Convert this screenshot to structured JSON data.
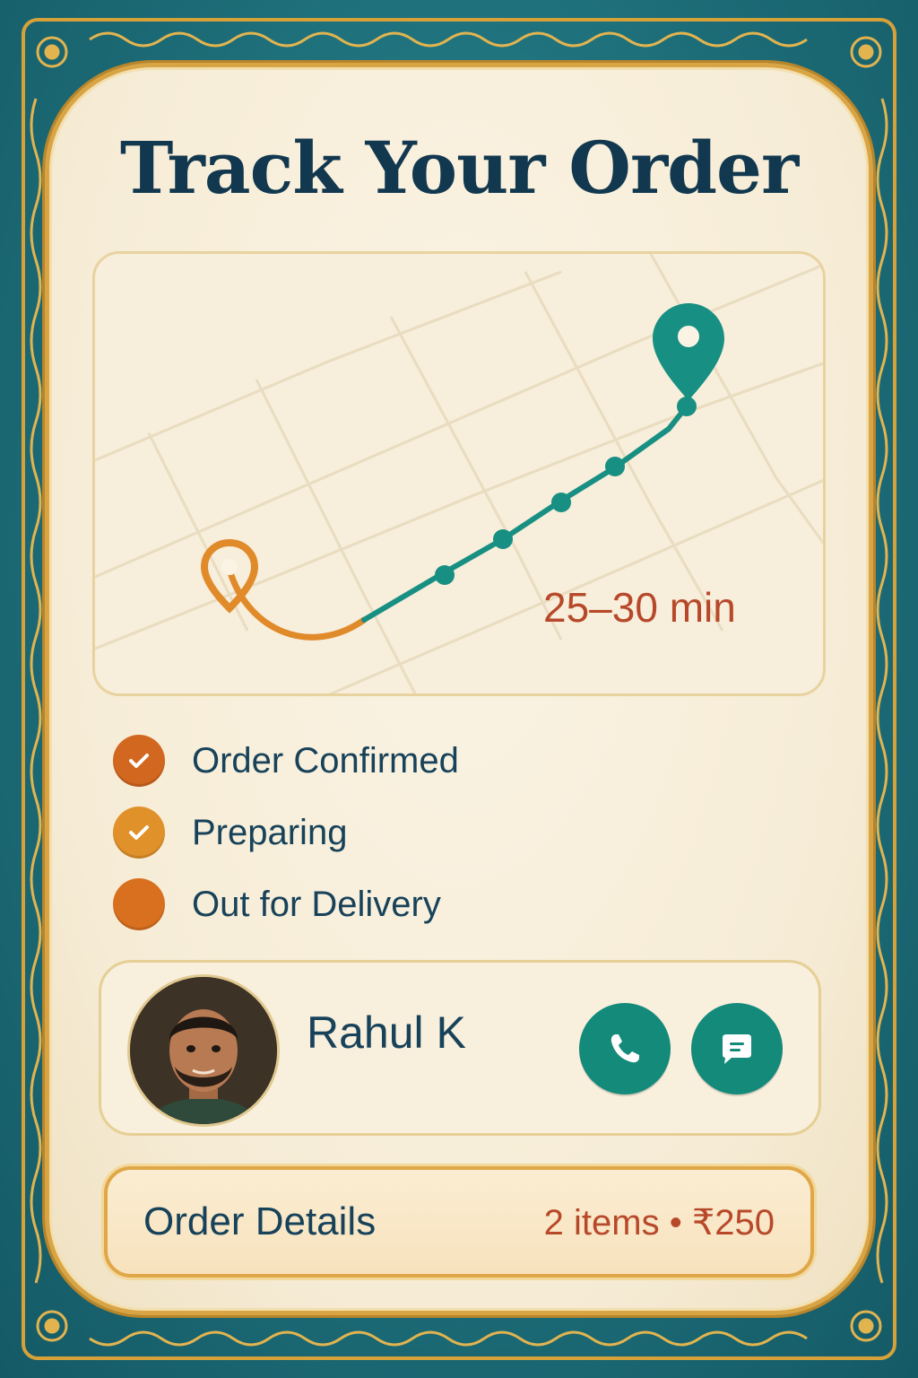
{
  "page": {
    "title": "Track Your Order"
  },
  "map": {
    "eta": "25–30 min",
    "route_colors": {
      "traveled": "#e08a2a",
      "remaining": "#178f82"
    }
  },
  "status": [
    {
      "label": "Order Confirmed",
      "state": "done",
      "color": "#d2671f",
      "icon": "check-icon"
    },
    {
      "label": "Preparing",
      "state": "done",
      "color": "#e1912a",
      "icon": "check-icon"
    },
    {
      "label": "Out for Delivery",
      "state": "current",
      "color": "#d8701f",
      "icon": "none"
    }
  ],
  "driver": {
    "name": "Rahul K",
    "actions": [
      {
        "name": "call-button",
        "icon": "phone-icon"
      },
      {
        "name": "message-button",
        "icon": "chat-icon"
      }
    ]
  },
  "order": {
    "label": "Order Details",
    "summary": "2 items • ₹250"
  },
  "colors": {
    "teal": "#148a7a",
    "navy": "#12384f",
    "accent_red": "#b7492a",
    "gold": "#d9a444"
  }
}
